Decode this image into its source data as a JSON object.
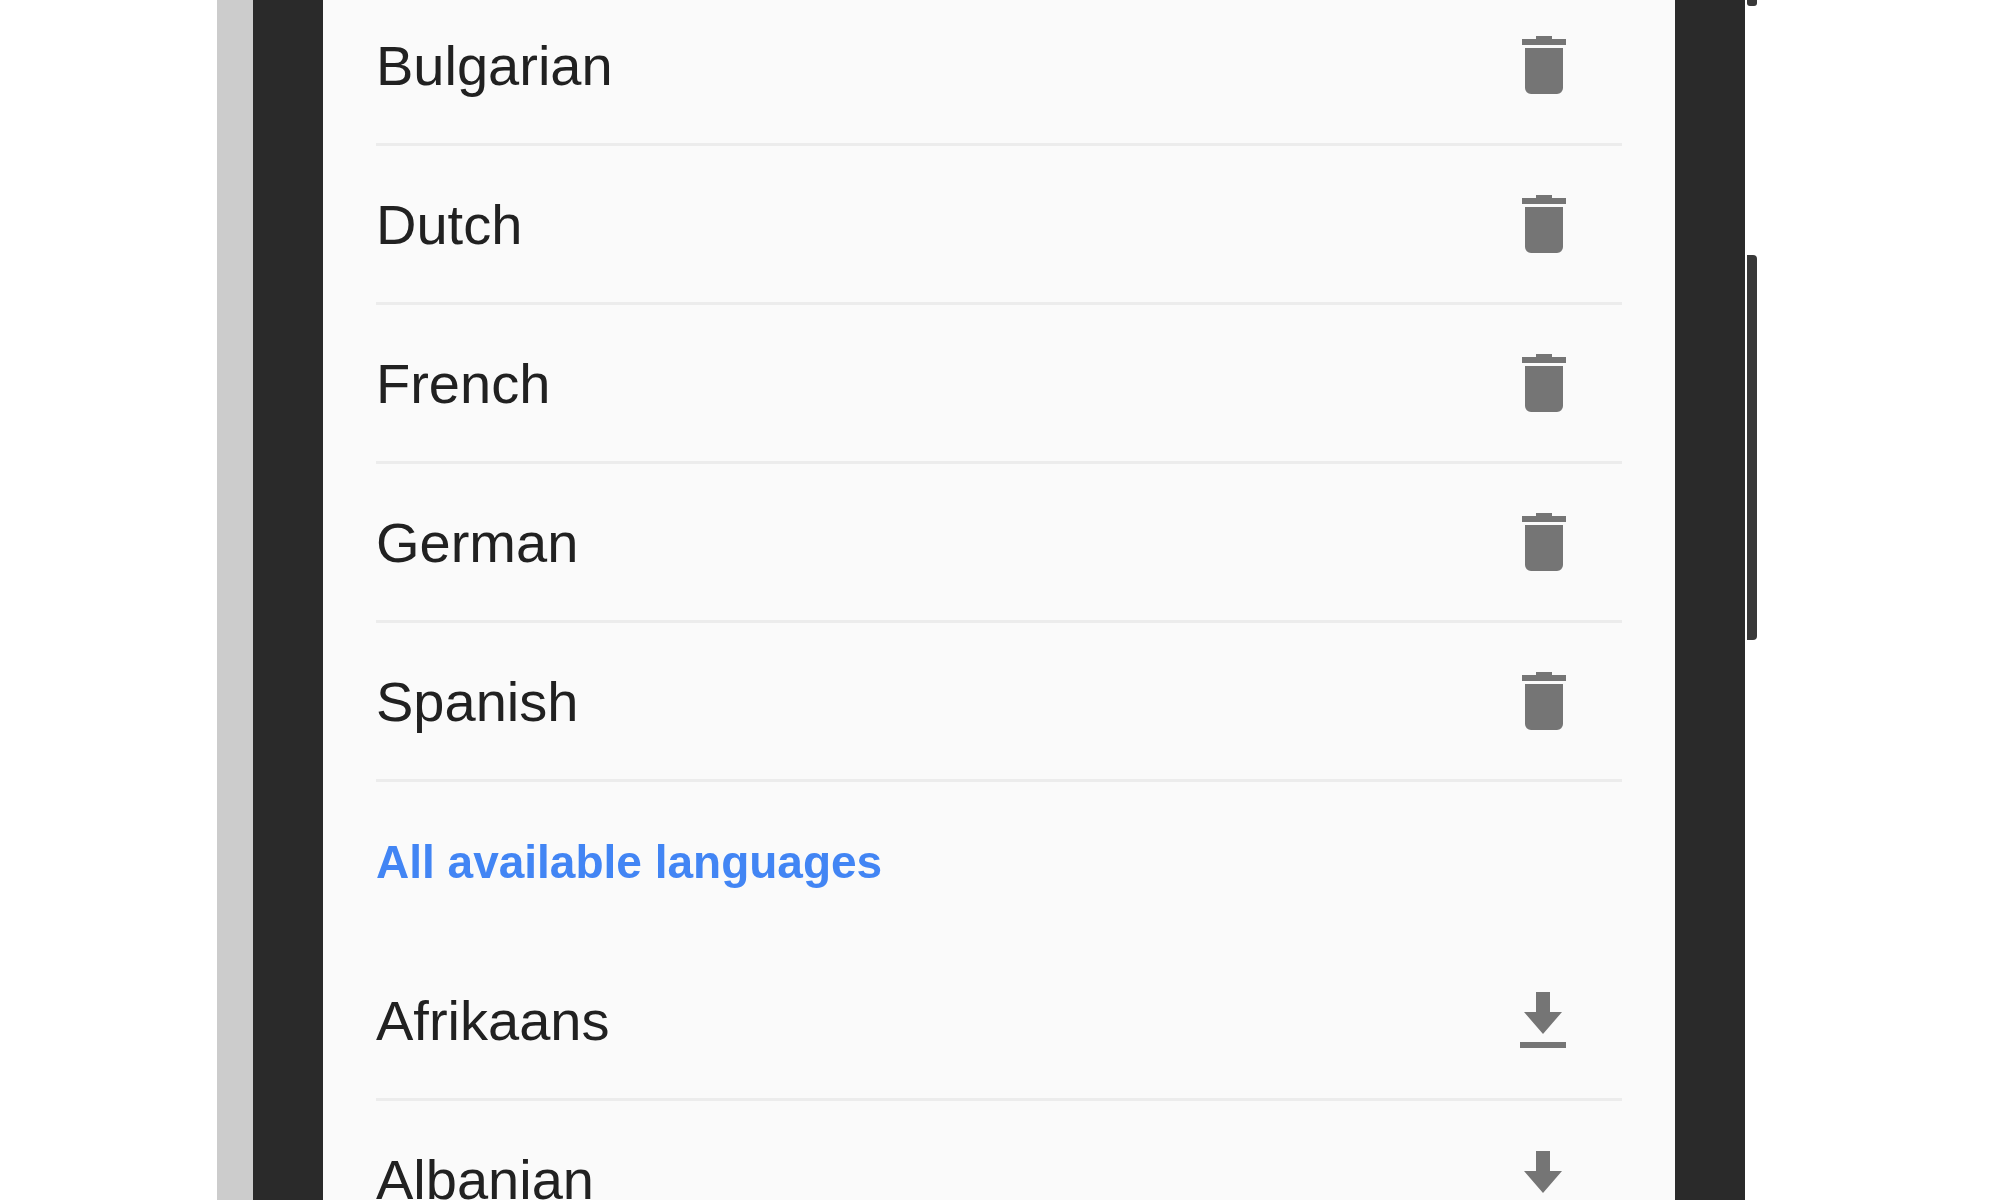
{
  "downloaded_languages": [
    {
      "name": "Bulgarian",
      "kind": "delete"
    },
    {
      "name": "Dutch",
      "kind": "delete"
    },
    {
      "name": "French",
      "kind": "delete"
    },
    {
      "name": "German",
      "kind": "delete"
    },
    {
      "name": "Spanish",
      "kind": "delete"
    }
  ],
  "available_section": {
    "title": "All available languages",
    "languages": [
      {
        "name": "Afrikaans",
        "kind": "download"
      },
      {
        "name": "Albanian",
        "kind": "download"
      }
    ]
  }
}
